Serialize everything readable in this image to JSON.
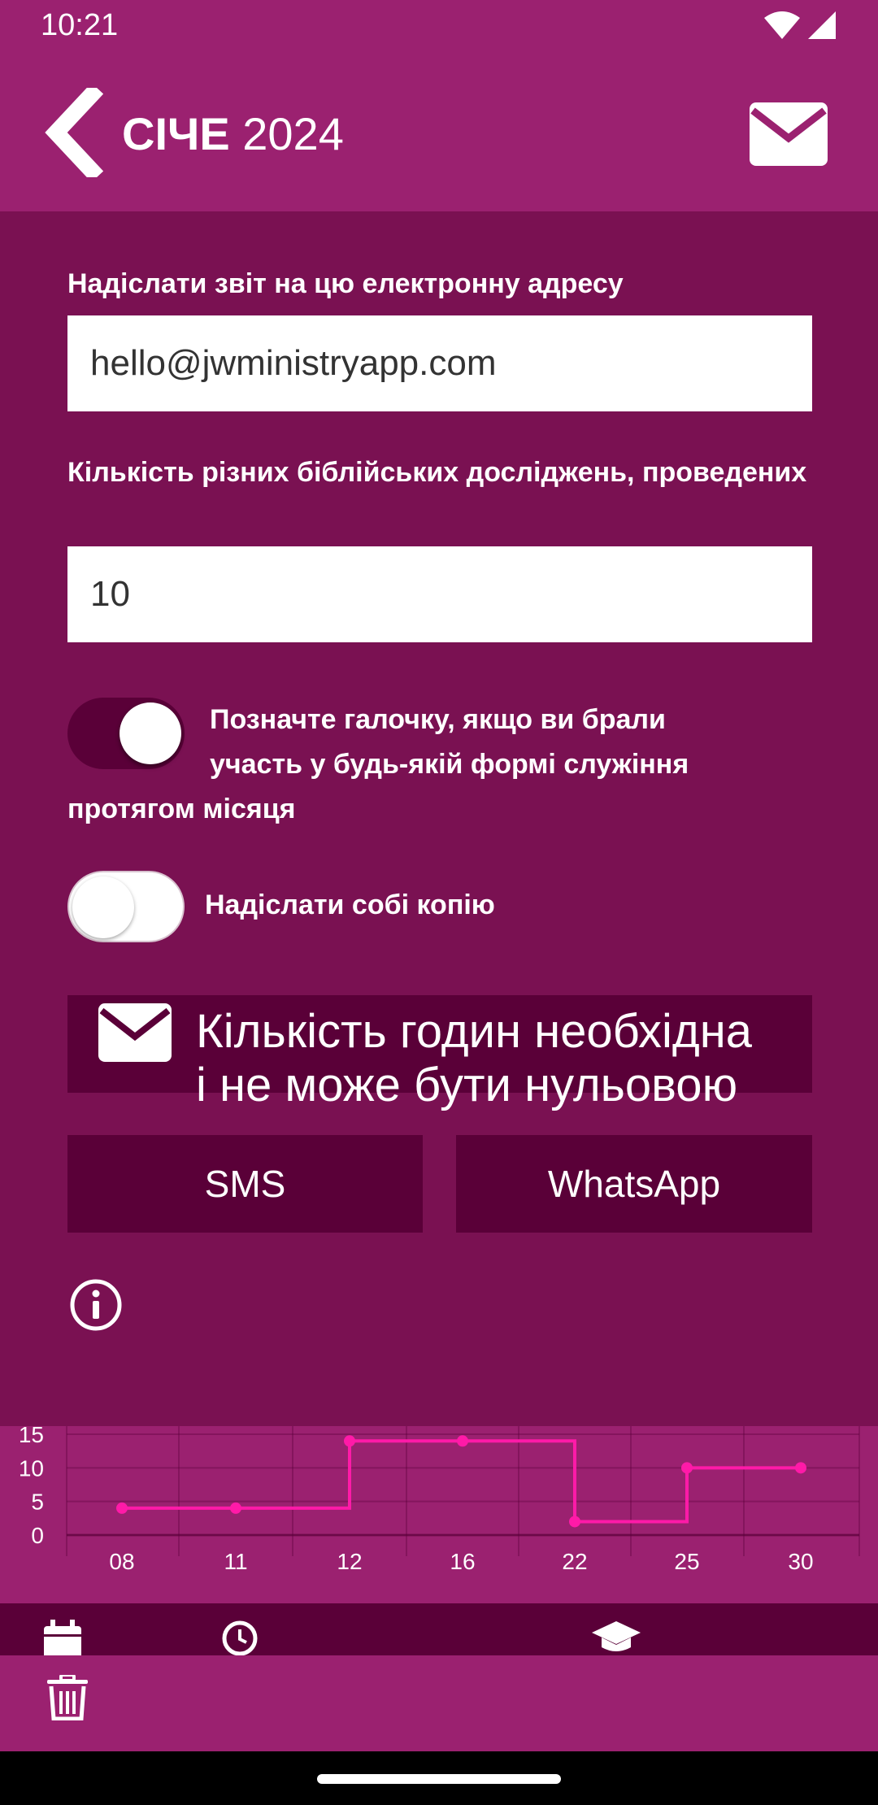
{
  "status_bar": {
    "time": "10:21"
  },
  "header": {
    "month": "СІЧЕ",
    "year": "2024"
  },
  "form": {
    "email_label": "Надіслати звіт на цю електронну адресу",
    "email_value": "hello@jwministryapp.com",
    "studies_label": "Кількість різних біблійських досліджень, проведених",
    "studies_value": "10",
    "participation_toggle": {
      "checked": true,
      "label_line1": "Позначте галочку, якщо ви брали",
      "label_line2": "участь у будь-якій формі служіння",
      "label_line3": "протягом місяця"
    },
    "copy_toggle": {
      "checked": false,
      "label": "Надіслати собі копію"
    }
  },
  "actions": {
    "email_button_line1": "Кількість годин необхідна",
    "email_button_line2": "і не може бути нульовою",
    "sms_label": "SMS",
    "whatsapp_label": "WhatsApp"
  },
  "colors": {
    "background": "#7a1152",
    "header": "#9b2170",
    "button": "#5a0038",
    "chart_line": "#ff1aa8"
  },
  "chart_data": {
    "type": "line",
    "interpolation": "step-after",
    "categories": [
      "08",
      "11",
      "12",
      "16",
      "22",
      "25",
      "30"
    ],
    "values": [
      4,
      4,
      14,
      14,
      2,
      10,
      10
    ],
    "y_ticks": [
      0,
      5,
      10,
      15
    ],
    "ylim": [
      0,
      15
    ],
    "grid": true,
    "title": "",
    "xlabel": "",
    "ylabel": ""
  },
  "icons": {
    "back": "chevron-left-icon",
    "mail": "envelope-icon",
    "info": "info-circle-icon",
    "delete": "trash-icon",
    "nav": [
      "calendar-icon",
      "clock-icon",
      "graduation-cap-icon"
    ]
  }
}
